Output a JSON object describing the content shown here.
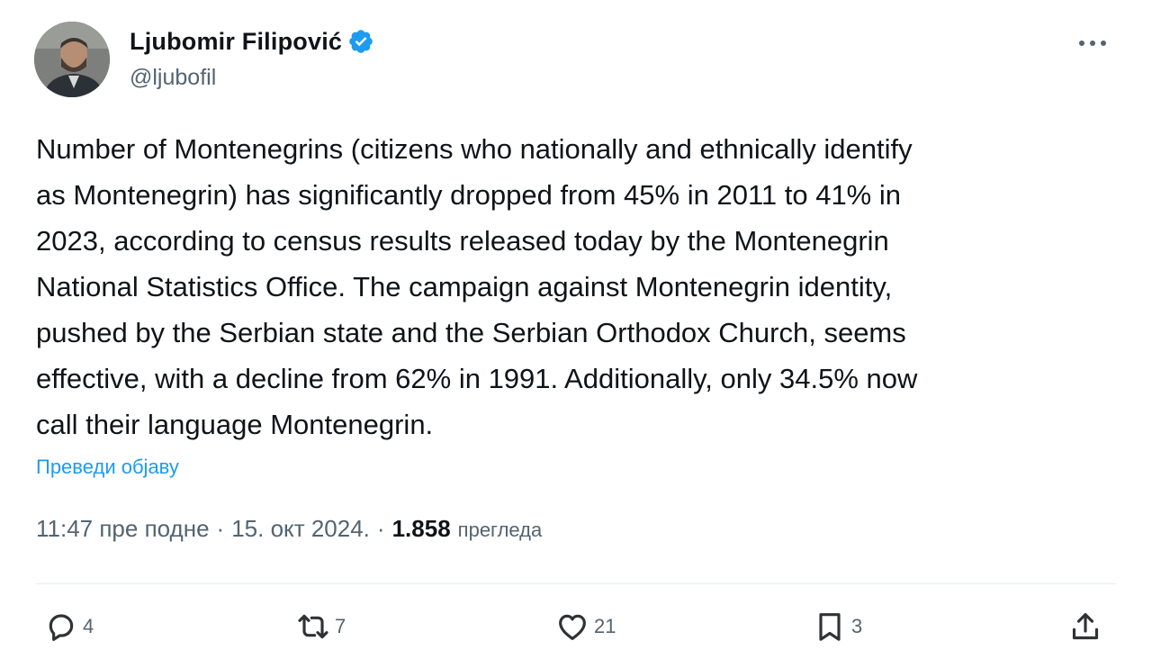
{
  "author": {
    "display_name": "Ljubomir Filipović",
    "handle": "@ljubofil",
    "verified": true
  },
  "tweet": {
    "text": "Number of Montenegrins (citizens who nationally and ethnically identify\nas Montenegrin) has significantly dropped from 45% in 2011 to 41% in\n2023, according to census results released today by the Montenegrin\nNational Statistics Office. The campaign against Montenegrin identity,\npushed by the Serbian state and the Serbian Orthodox Church, seems\neffective, with a decline from 62% in 1991. Additionally, only 34.5% now\ncall their language Montenegrin.",
    "translate_label": "Преведи објаву",
    "time": "11:47 пре подне",
    "date": "15. окт 2024.",
    "separator": "·",
    "views_count": "1.858",
    "views_label": "прегледа"
  },
  "actions": {
    "replies": "4",
    "reposts": "7",
    "likes": "21",
    "bookmarks": "3"
  },
  "icons": {
    "verified": "verified-badge-icon",
    "more": "more-dots-icon",
    "reply": "reply-icon",
    "repost": "repost-icon",
    "like": "heart-icon",
    "bookmark": "bookmark-icon",
    "share": "share-icon"
  },
  "colors": {
    "accent": "#1d9bf0",
    "text_primary": "#0f1419",
    "text_secondary": "#536471"
  }
}
